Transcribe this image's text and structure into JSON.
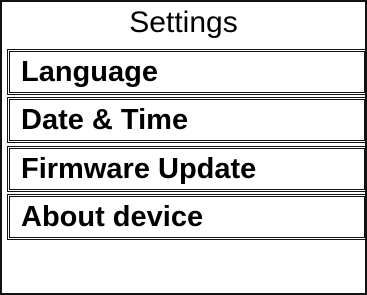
{
  "header": {
    "title": "Settings"
  },
  "menu": {
    "items": [
      {
        "label": "Language"
      },
      {
        "label": "Date & Time"
      },
      {
        "label": "Firmware Update"
      },
      {
        "label": "About device"
      }
    ]
  }
}
